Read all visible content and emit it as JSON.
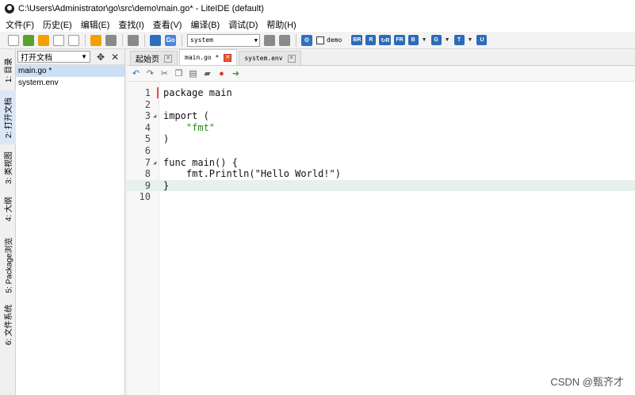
{
  "window": {
    "title": "C:\\Users\\Administrator\\go\\src\\demo\\main.go* - LiteIDE (default)"
  },
  "menu": [
    "文件(F)",
    "历史(E)",
    "编辑(E)",
    "查找(I)",
    "查看(V)",
    "编译(B)",
    "调试(D)",
    "帮助(H)"
  ],
  "toolbar": {
    "env_select": "system",
    "demo_label": "demo",
    "build_buttons": [
      "BR",
      "R",
      "↻R",
      "FR",
      "B",
      "G",
      "T",
      "U"
    ]
  },
  "side_tabs": [
    "1: 目录",
    "2: 打开文档",
    "3: 类视图",
    "4: 大纲",
    "5: Package浏览",
    "6: 文件系统"
  ],
  "left_panel": {
    "select_label": "打开文档",
    "files": [
      "main.go *",
      "system.env"
    ]
  },
  "editor_tabs": [
    {
      "label": "起始页"
    },
    {
      "label": "main.go *"
    },
    {
      "label": "system.env"
    }
  ],
  "code": {
    "line_numbers": [
      "1",
      "2",
      "3",
      "4",
      "5",
      "6",
      "7",
      "8",
      "9",
      "10"
    ],
    "lines": [
      "package main",
      "",
      "import (",
      "    \"fmt\"",
      ")",
      "",
      "func main() {",
      "    fmt.Println(\"Hello World!\")",
      "}",
      ""
    ],
    "current_line": 9
  },
  "watermark": "CSDN @甄齐才"
}
